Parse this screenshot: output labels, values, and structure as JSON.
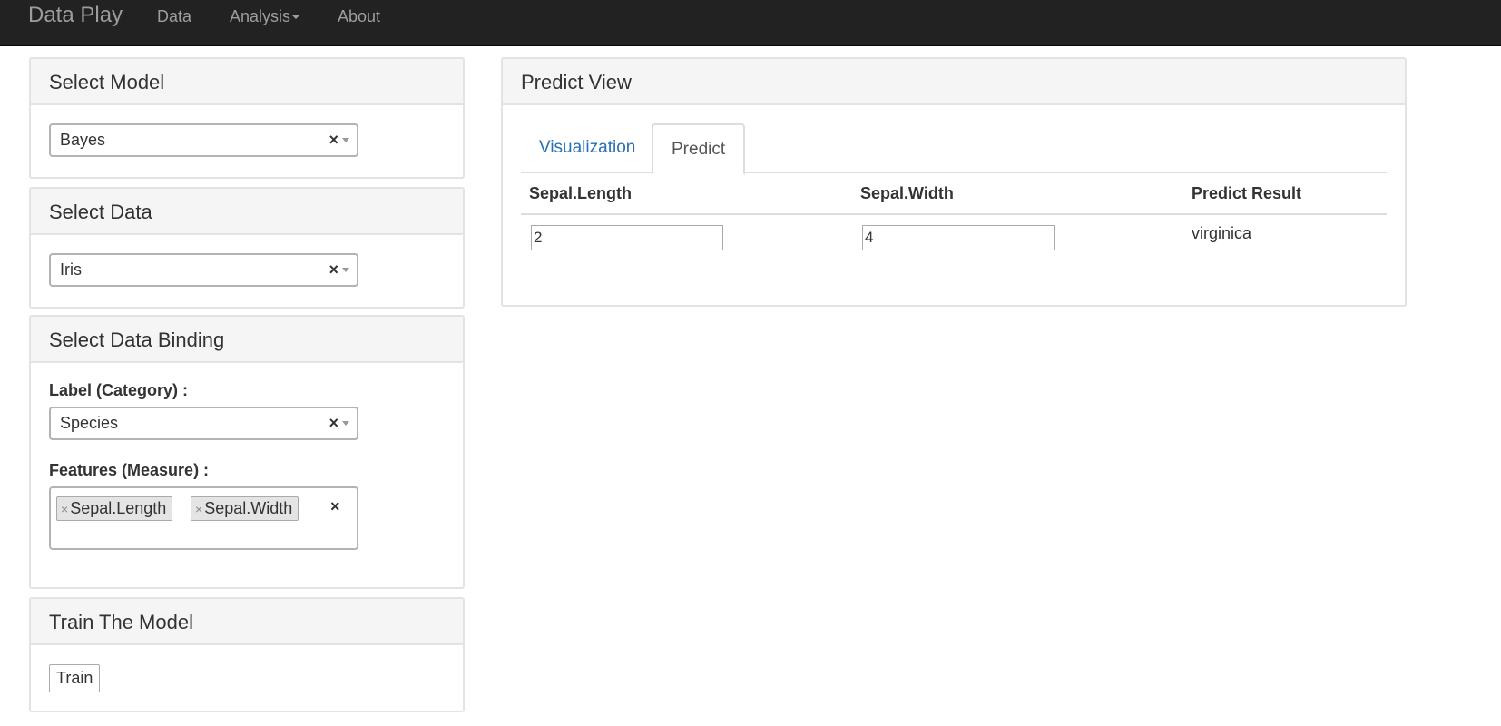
{
  "navbar": {
    "brand": "Data Play",
    "items": [
      {
        "label": "Data"
      },
      {
        "label": "Analysis"
      },
      {
        "label": "About"
      }
    ]
  },
  "panels": {
    "select_model": {
      "title": "Select Model",
      "value": "Bayes",
      "clear_glyph": "×"
    },
    "select_data": {
      "title": "Select Data",
      "value": "Iris",
      "clear_glyph": "×"
    },
    "data_binding": {
      "title": "Select Data Binding",
      "label_field": "Label (Category) :",
      "label_value": "Species",
      "features_field": "Features (Measure) :",
      "features": [
        "Sepal.Length",
        "Sepal.Width"
      ],
      "token_remove_glyph": "×",
      "clear_glyph": "×"
    },
    "train": {
      "title": "Train The Model",
      "button_label": "Train"
    }
  },
  "predict_view": {
    "title": "Predict View",
    "tabs": [
      {
        "label": "Visualization",
        "active": false
      },
      {
        "label": "Predict",
        "active": true
      }
    ],
    "table": {
      "headers": [
        "Sepal.Length",
        "Sepal.Width",
        "Predict Result"
      ],
      "row": {
        "sepal_length": "2",
        "sepal_width": "4",
        "result": "virginica"
      }
    }
  },
  "colors": {
    "navbar_bg": "#222222",
    "navbar_text": "#9d9d9d",
    "link_blue": "#2a6fb3",
    "panel_heading_bg": "#f5f5f5"
  }
}
